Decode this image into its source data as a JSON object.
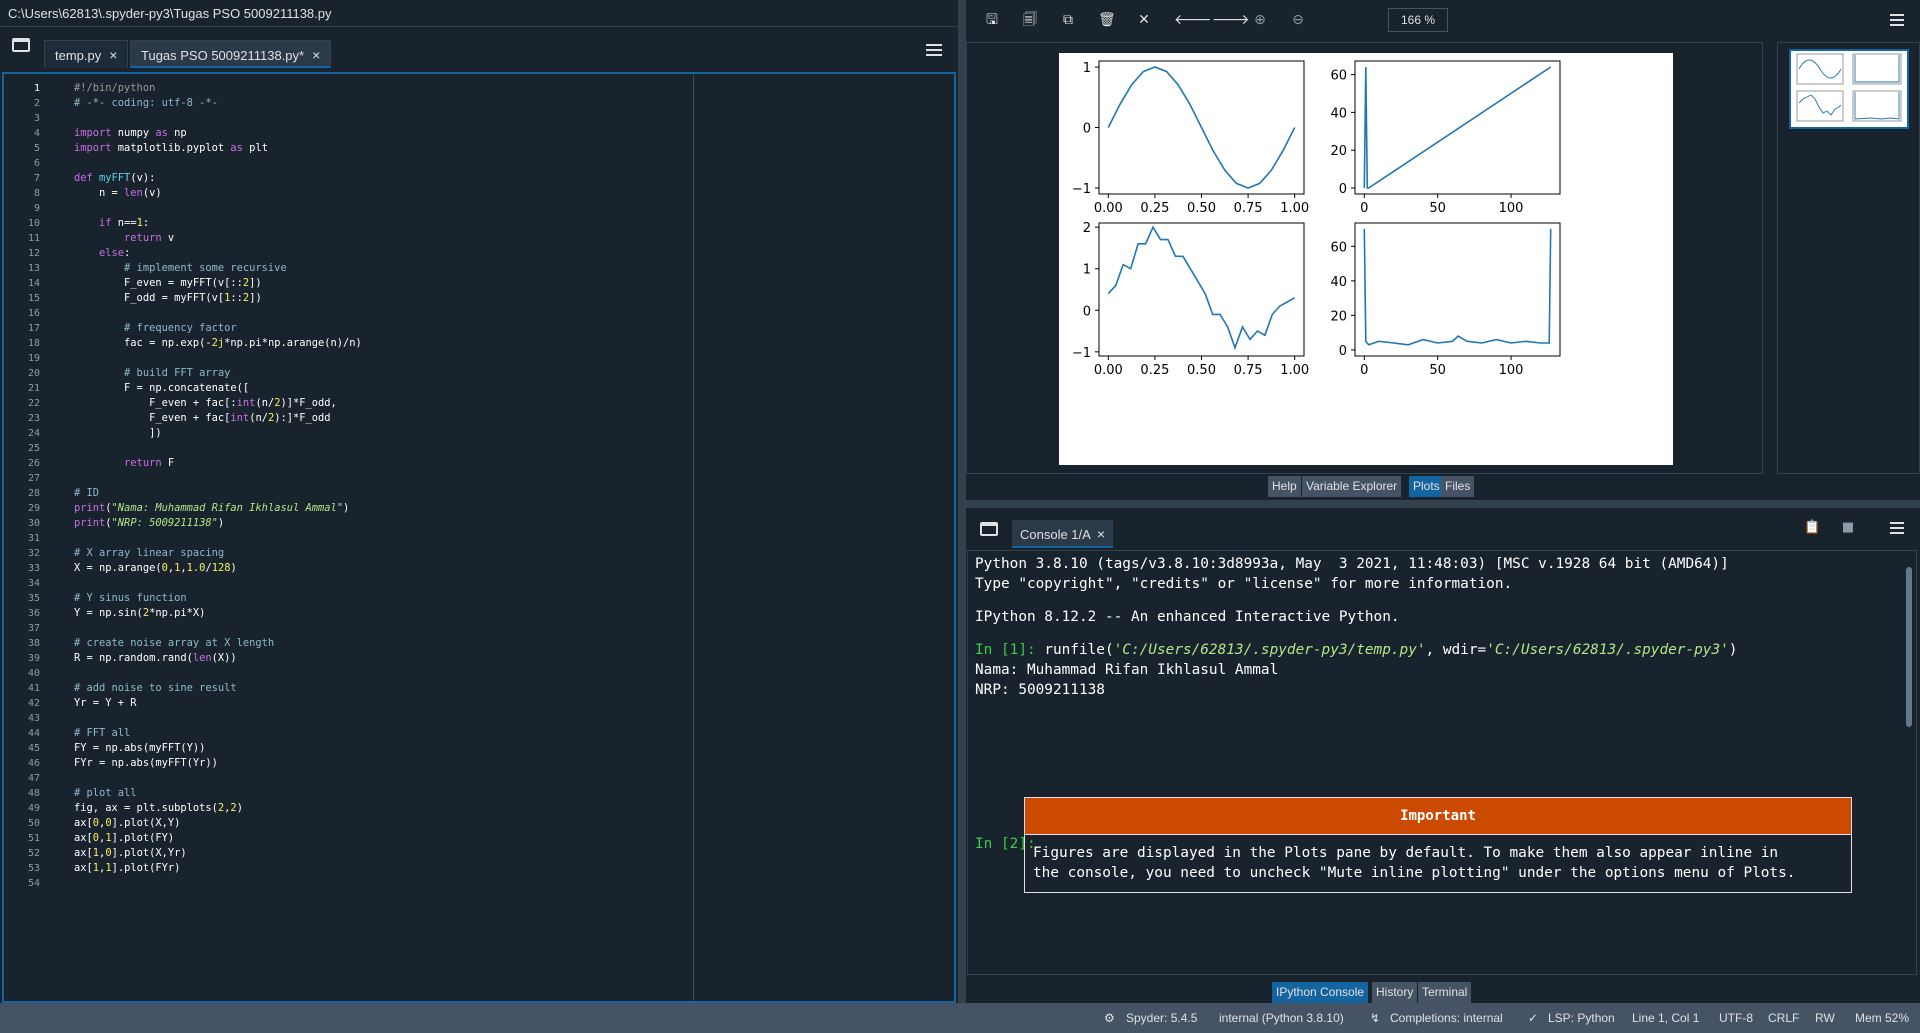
{
  "window": {
    "path": "C:\\Users\\62813\\.spyder-py3\\Tugas PSO 5009211138.py"
  },
  "editor": {
    "tabs": [
      {
        "label": "temp.py",
        "close": "×"
      },
      {
        "label": "Tugas PSO 5009211138.py*",
        "close": "×"
      }
    ],
    "line_numbers": [
      "1",
      "2",
      "3",
      "4",
      "5",
      "6",
      "7",
      "8",
      "9",
      "10",
      "11",
      "12",
      "13",
      "14",
      "15",
      "16",
      "17",
      "18",
      "19",
      "20",
      "21",
      "22",
      "23",
      "24",
      "25",
      "26",
      "27",
      "28",
      "29",
      "30",
      "31",
      "32",
      "33",
      "34",
      "35",
      "36",
      "37",
      "38",
      "39",
      "40",
      "41",
      "42",
      "43",
      "44",
      "45",
      "46",
      "47",
      "48",
      "49",
      "50",
      "51",
      "52",
      "53",
      "54"
    ],
    "code": {
      "l1": "#!/bin/python",
      "l2": "# -*- coding: utf-8 -*-",
      "l4_import": "import",
      "l4_mod": " numpy ",
      "l4_as": "as",
      "l4_alias": " np",
      "l5_import": "import",
      "l5_mod": " matplotlib.pyplot ",
      "l5_as": "as",
      "l5_alias": " plt",
      "l7_def": "def",
      "l7_name": " myFFT",
      "l7_rest": "(v):",
      "l8_a": "    n = ",
      "l8_len": "len",
      "l8_b": "(v)",
      "l10_if": "    if",
      "l10_a": " n==",
      "l10_num": "1",
      "l10_b": ":",
      "l11_ret": "        return",
      "l11_v": " v",
      "l12_else": "    else",
      "l12_colon": ":",
      "l13": "        # implement some recursive",
      "l14_a": "        F_even = myFFT(v[::",
      "l14_n": "2",
      "l14_b": "])",
      "l15_a": "        F_odd = myFFT(v[",
      "l15_n1": "1",
      "l15_m": "::",
      "l15_n2": "2",
      "l15_b": "])",
      "l17": "        # frequency factor",
      "l18_a": "        fac = np.exp(-",
      "l18_n": "2j",
      "l18_b": "*np.pi*np.arange(n)/n)",
      "l20": "        # build FFT array",
      "l21": "        F = np.concatenate([",
      "l22_a": "            F_even + fac[:",
      "l22_int": "int",
      "l22_b": "(n/",
      "l22_n": "2",
      "l22_c": ")]*F_odd,",
      "l23_a": "            F_even + fac[",
      "l23_int": "int",
      "l23_b": "(n/",
      "l23_n": "2",
      "l23_c": "):]*F_odd",
      "l24": "            ])",
      "l26_ret": "        return",
      "l26_f": " F",
      "l28": "# ID",
      "l29_print": "print",
      "l29_a": "(",
      "l29_str": "\"Nama: Muhammad Rifan Ikhlasul Ammal\"",
      "l29_b": ")",
      "l30_print": "print",
      "l30_a": "(",
      "l30_str": "\"NRP: 5009211138\"",
      "l30_b": ")",
      "l32": "# X array linear spacing",
      "l33_a": "X = np.arange(",
      "l33_n1": "0",
      "l33_c1": ",",
      "l33_n2": "1",
      "l33_c2": ",",
      "l33_n3": "1.0",
      "l33_s": "/",
      "l33_n4": "128",
      "l33_b": ")",
      "l35": "# Y sinus function",
      "l36_a": "Y = np.sin(",
      "l36_n": "2",
      "l36_b": "*np.pi*X)",
      "l38": "# create noise array at X length",
      "l39_a": "R = np.random.rand(",
      "l39_len": "len",
      "l39_b": "(X))",
      "l41": "# add noise to sine result",
      "l42": "Yr = Y + R",
      "l44": "# FFT all",
      "l45": "FY = np.abs(myFFT(Y))",
      "l46": "FYr = np.abs(myFFT(Yr))",
      "l48": "# plot all",
      "l49_a": "fig, ax = plt.subplots(",
      "l49_n1": "2",
      "l49_c": ",",
      "l49_n2": "2",
      "l49_b": ")",
      "l50_a": "ax[",
      "l50_n1": "0",
      "l50_c": ",",
      "l50_n2": "0",
      "l50_b": "].plot(X,Y)",
      "l51_a": "ax[",
      "l51_n1": "0",
      "l51_c": ",",
      "l51_n2": "1",
      "l51_b": "].plot(FY)",
      "l52_a": "ax[",
      "l52_n1": "1",
      "l52_c": ",",
      "l52_n2": "0",
      "l52_b": "].plot(X,Yr)",
      "l53_a": "ax[",
      "l53_n1": "1",
      "l53_c": ",",
      "l53_n2": "1",
      "l53_b": "].plot(FYr)"
    }
  },
  "plots": {
    "zoom": "166 %",
    "toolbar_icons": [
      "save-icon",
      "save-all-icon",
      "copy-icon",
      "trash-icon",
      "close-all-icon",
      "arrow-left-icon",
      "arrow-right-icon",
      "zoom-in-icon",
      "zoom-out-icon"
    ],
    "tabs": [
      "Help",
      "Variable Explorer",
      "Plots",
      "Files"
    ],
    "active_tab": "Plots"
  },
  "chart_data": [
    {
      "type": "line",
      "x": [
        0,
        0.0625,
        0.125,
        0.1875,
        0.25,
        0.3125,
        0.375,
        0.4375,
        0.5,
        0.5625,
        0.625,
        0.6875,
        0.75,
        0.8125,
        0.875,
        0.9375,
        1.0
      ],
      "y": [
        0,
        0.383,
        0.707,
        0.924,
        1,
        0.924,
        0.707,
        0.383,
        0,
        -0.383,
        -0.707,
        -0.924,
        -1,
        -0.924,
        -0.707,
        -0.383,
        0
      ],
      "xticks": [
        "0.00",
        "0.25",
        "0.50",
        "0.75",
        "1.00"
      ],
      "yticks": [
        "1",
        "0",
        "−1"
      ],
      "xlim": [
        -0.05,
        1.05
      ],
      "ylim": [
        -1.1,
        1.1
      ],
      "color": "#1f77b4"
    },
    {
      "type": "line",
      "x": [
        0,
        1,
        2,
        3,
        127
      ],
      "y": [
        0,
        64,
        0,
        0,
        64
      ],
      "xticks": [
        "0",
        "50",
        "100"
      ],
      "yticks": [
        "60",
        "40",
        "20",
        "0"
      ],
      "xlim": [
        -6.35,
        133.35
      ],
      "ylim": [
        -3.2,
        67.2
      ],
      "color": "#1f77b4"
    },
    {
      "type": "line",
      "x": [
        0,
        0.04,
        0.08,
        0.12,
        0.16,
        0.2,
        0.24,
        0.28,
        0.32,
        0.36,
        0.4,
        0.44,
        0.48,
        0.52,
        0.56,
        0.6,
        0.64,
        0.68,
        0.72,
        0.76,
        0.8,
        0.84,
        0.88,
        0.92,
        0.96,
        1.0
      ],
      "y": [
        0.4,
        0.6,
        1.1,
        1.0,
        1.6,
        1.6,
        2.0,
        1.7,
        1.7,
        1.3,
        1.3,
        1.0,
        0.7,
        0.4,
        -0.1,
        -0.1,
        -0.4,
        -0.9,
        -0.4,
        -0.7,
        -0.5,
        -0.6,
        -0.1,
        0.1,
        0.2,
        0.3
      ],
      "xticks": [
        "0.00",
        "0.25",
        "0.50",
        "0.75",
        "1.00"
      ],
      "yticks": [
        "2",
        "1",
        "0",
        "−1"
      ],
      "xlim": [
        -0.05,
        1.05
      ],
      "ylim": [
        -1.1,
        2.1
      ],
      "color": "#1f77b4"
    },
    {
      "type": "line",
      "x": [
        0,
        1,
        3,
        10,
        20,
        30,
        40,
        50,
        60,
        64,
        70,
        80,
        90,
        100,
        110,
        120,
        126,
        127
      ],
      "y": [
        70,
        5,
        3,
        5,
        4,
        3,
        6,
        4,
        5,
        8,
        5,
        4,
        6,
        4,
        5,
        4,
        4,
        70
      ],
      "xticks": [
        "0",
        "50",
        "100"
      ],
      "yticks": [
        "60",
        "40",
        "20",
        "0"
      ],
      "xlim": [
        -6.35,
        133.35
      ],
      "ylim": [
        -3.5,
        73.5
      ],
      "color": "#1f77b4"
    }
  ],
  "console": {
    "tab": "Console 1/A",
    "close": "×",
    "lines": {
      "l1": "Python 3.8.10 (tags/v3.8.10:3d8993a, May  3 2021, 11:48:03) [MSC v.1928 64 bit (AMD64)]",
      "l2": "Type \"copyright\", \"credits\" or \"license\" for more information.",
      "l3": "IPython 8.12.2 -- An enhanced Interactive Python.",
      "p1": "In [1]: ",
      "run_a": "runfile(",
      "run_b": "'C:/Users/62813/.spyder-py3/temp.py'",
      "run_c": ", wdir=",
      "run_d": "'C:/Users/62813/.spyder-py3'",
      "run_e": ")",
      "out1": "Nama: Muhammad Rifan Ikhlasul Ammal",
      "out2": "NRP: 5009211138",
      "p2": "In [2]: "
    },
    "important": {
      "title": "Important",
      "line1": "Figures are displayed in the Plots pane by default. To make them also appear inline in",
      "line2": "the console, you need to uncheck \"Mute inline plotting\" under the options menu of Plots."
    },
    "tabs": [
      "IPython Console",
      "History",
      "Terminal"
    ],
    "active_tab": "IPython Console"
  },
  "status": {
    "spyder": "Spyder: 5.4.5",
    "interpreter": "internal (Python 3.8.10)",
    "completions": "Completions: internal",
    "lsp": "LSP: Python",
    "position": "Line 1, Col 1",
    "encoding": "UTF-8",
    "eol": "CRLF",
    "mode": "RW",
    "mem": "Mem 52%"
  }
}
